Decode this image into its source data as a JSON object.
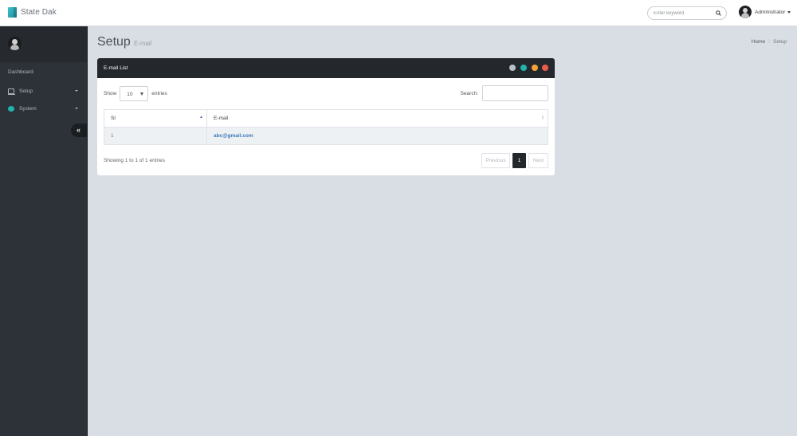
{
  "app": {
    "brand": "State Dak"
  },
  "topbar": {
    "search_placeholder": "Enter keyword",
    "user_name": "Administrator"
  },
  "sidebar": {
    "section_label": "Dashboard",
    "items": [
      {
        "label": "Setup",
        "icon": "monitor-icon"
      },
      {
        "label": "System",
        "icon": "dot-icon"
      }
    ],
    "collapse_glyph": "«"
  },
  "page": {
    "title": "Setup",
    "subtitle": "E-mail",
    "breadcrumb": [
      "Home",
      "Setup"
    ],
    "breadcrumb_sep": "/"
  },
  "panel": {
    "title": "E-mail List",
    "controls": [
      {
        "name": "collapse-control",
        "glyph": "",
        "color": "#b8c1c9"
      },
      {
        "name": "refresh-control",
        "glyph": "",
        "color": "#1fb5ad"
      },
      {
        "name": "minimize-control",
        "glyph": "",
        "color": "#f7a335"
      },
      {
        "name": "close-control",
        "glyph": "",
        "color": "#ec5c4b"
      }
    ]
  },
  "table": {
    "show_label": "Show",
    "length_value": "10",
    "entries_label": "entries",
    "search_label": "Search:",
    "columns": [
      "Sl",
      "E-mail"
    ],
    "rows": [
      {
        "sl": "1",
        "email": "abc@gmail.com"
      }
    ],
    "info": "Showing 1 to 1 of 1 entries",
    "pagination": {
      "previous": "Previous",
      "current": "1",
      "next": "Next"
    }
  }
}
